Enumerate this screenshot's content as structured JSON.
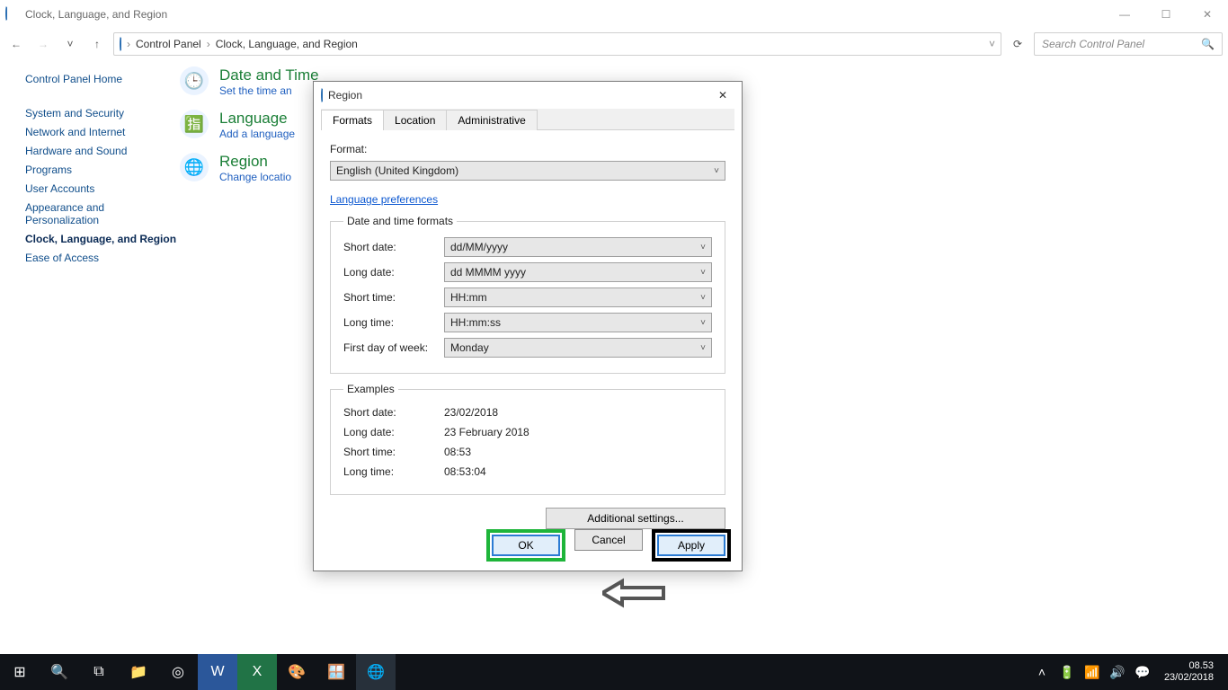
{
  "window": {
    "title": "Clock, Language, and Region",
    "win_ctrls": {
      "min": "—",
      "max": "☐",
      "close": "✕"
    }
  },
  "breadcrumb": {
    "root": "Control Panel",
    "leaf": "Clock, Language, and Region",
    "sep": "›"
  },
  "nav": {
    "refresh_glyph": "⟳",
    "dropdown_glyph": "˅",
    "up_glyph": "↑",
    "back_glyph": "←",
    "fwd_glyph": "→"
  },
  "search": {
    "placeholder": "Search Control Panel",
    "lens": "🔍"
  },
  "sidebar": {
    "items": [
      {
        "label": "Control Panel Home",
        "active": false
      },
      {
        "label": "System and Security",
        "active": false
      },
      {
        "label": "Network and Internet",
        "active": false
      },
      {
        "label": "Hardware and Sound",
        "active": false
      },
      {
        "label": "Programs",
        "active": false
      },
      {
        "label": "User Accounts",
        "active": false
      },
      {
        "label": "Appearance and Personalization",
        "active": false
      },
      {
        "label": "Clock, Language, and Region",
        "active": true
      },
      {
        "label": "Ease of Access",
        "active": false
      }
    ]
  },
  "categories": [
    {
      "title": "Date and Time",
      "sub": "Set the time an",
      "icon_glyph": "🕒",
      "icon_bg": "#eaf3ff"
    },
    {
      "title": "Language",
      "sub": "Add a language",
      "icon_glyph": "🈯",
      "icon_bg": "#eaf3ff"
    },
    {
      "title": "Region",
      "sub": "Change locatio",
      "icon_glyph": "🌐",
      "icon_bg": "#eaf3ff"
    }
  ],
  "dialog": {
    "title": "Region",
    "close_glyph": "✕",
    "tabs": {
      "t0": "Formats",
      "t1": "Location",
      "t2": "Administrative"
    },
    "format_label": "Format:",
    "format_value": "English (United Kingdom)",
    "language_link": "Language preferences",
    "group_formats_caption": "Date and time formats",
    "rows": {
      "short_date": {
        "label": "Short date:",
        "value": "dd/MM/yyyy"
      },
      "long_date": {
        "label": "Long date:",
        "value": "dd MMMM yyyy"
      },
      "short_time": {
        "label": "Short time:",
        "value": "HH:mm"
      },
      "long_time": {
        "label": "Long time:",
        "value": "HH:mm:ss"
      },
      "first_day": {
        "label": "First day of week:",
        "value": "Monday"
      }
    },
    "group_examples_caption": "Examples",
    "examples": {
      "short_date": {
        "label": "Short date:",
        "value": "23/02/2018"
      },
      "long_date": {
        "label": "Long date:",
        "value": "23 February 2018"
      },
      "short_time": {
        "label": "Short time:",
        "value": "08:53"
      },
      "long_time": {
        "label": "Long time:",
        "value": "08:53:04"
      }
    },
    "additional_settings": "Additional settings...",
    "buttons": {
      "ok": "OK",
      "cancel": "Cancel",
      "apply": "Apply"
    },
    "chev": "˅"
  },
  "taskbar": {
    "icons": {
      "start": "⊞",
      "search": "🔍",
      "taskview": "⧉",
      "explorer": "📁",
      "chrome": "◎",
      "word": "W",
      "excel": "X",
      "paint": "🎨",
      "settings": "🪟",
      "globe": "🌐"
    },
    "tray": {
      "chev": "˄",
      "battery": "🔋",
      "wifi": "📶",
      "vol": "🔊",
      "notify": "💬"
    },
    "clock": {
      "time": "08.53",
      "date": "23/02/2018"
    }
  }
}
